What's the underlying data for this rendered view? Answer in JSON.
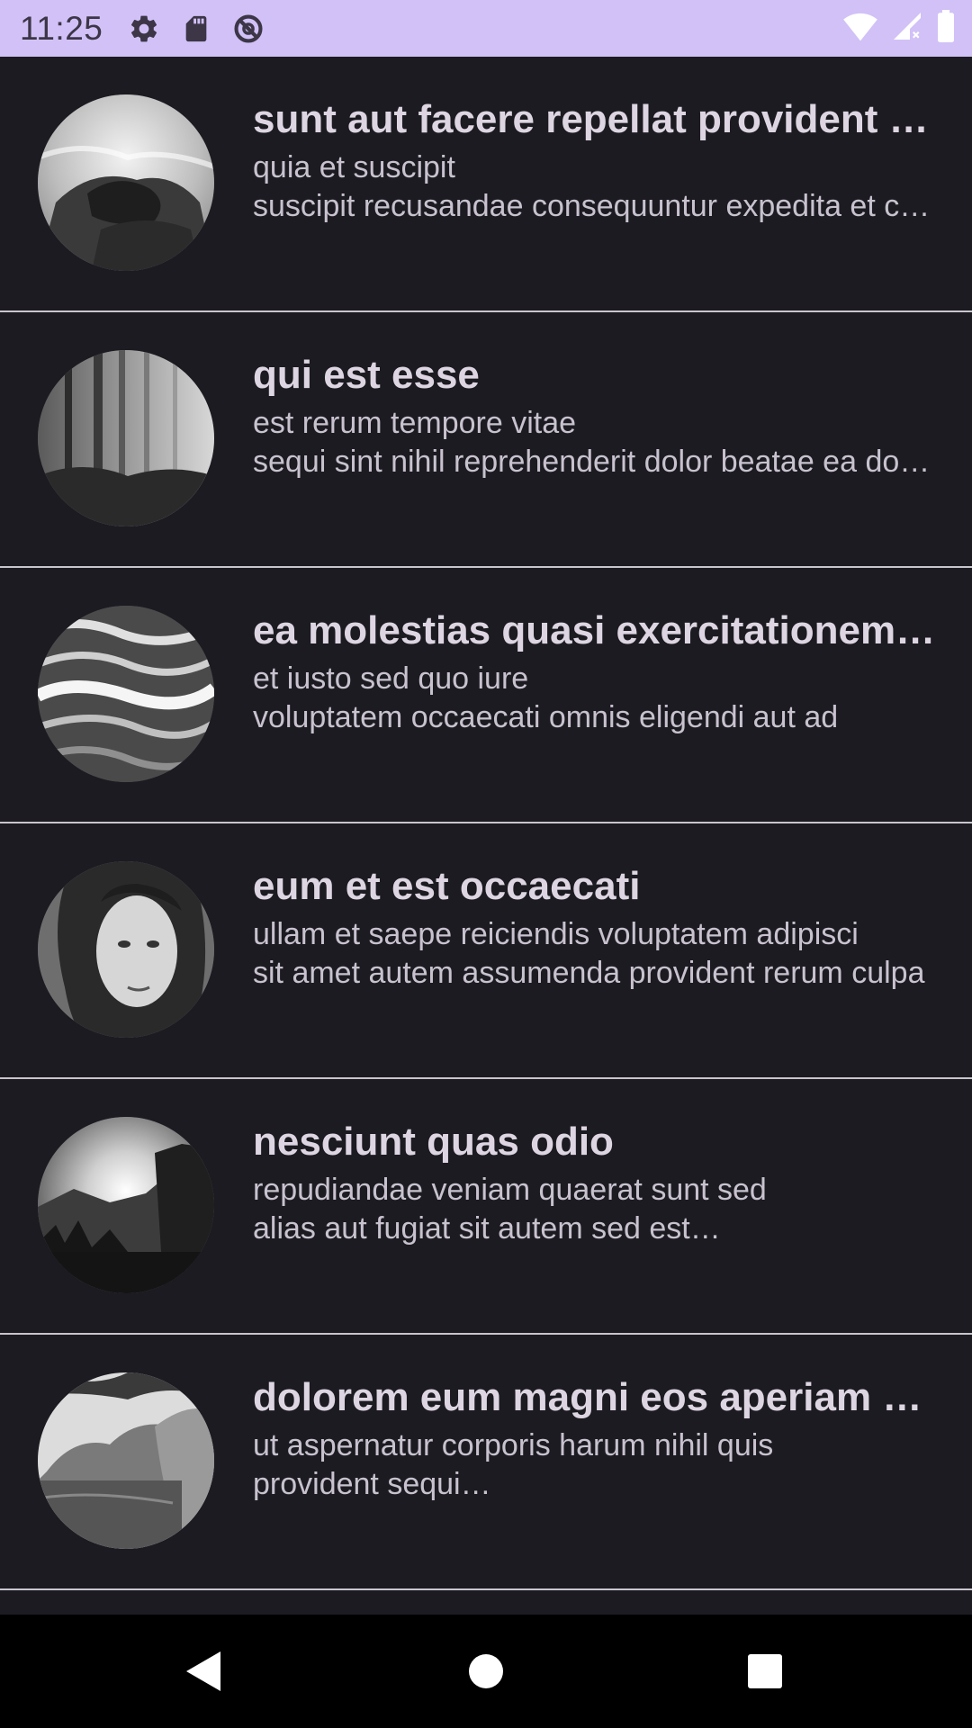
{
  "status_bar": {
    "time": "11:25",
    "left_icons": [
      "settings-icon",
      "sd-card-icon",
      "data-saver-icon"
    ],
    "right_icons": [
      "wifi-icon",
      "cellular-signal-icon",
      "battery-icon"
    ]
  },
  "posts": [
    {
      "title": "sunt aut facere repellat provident occaecati excepturi optio reprehenderit",
      "line1": "quia et suscipit",
      "line2": "suscipit recusandae consequuntur expedita et cum",
      "image": "rock-waves-image"
    },
    {
      "title": "qui est esse",
      "line1": "est rerum tempore vitae",
      "line2": "sequi sint nihil reprehenderit dolor beatae ea dolores neque",
      "image": "misty-forest-image"
    },
    {
      "title": "ea molestias quasi exercitationem repellat qui ipsa sit aut",
      "line1": "et iusto sed quo iure",
      "line2": "voluptatem occaecati omnis eligendi aut ad",
      "image": "ocean-waves-image"
    },
    {
      "title": "eum et est occaecati",
      "line1": "ullam et saepe reiciendis voluptatem adipisci",
      "line2": "sit amet autem assumenda provident rerum culpa",
      "image": "woman-portrait-image"
    },
    {
      "title": "nesciunt quas odio",
      "line1": "repudiandae veniam quaerat sunt sed",
      "line2": "alias aut fugiat sit autem sed est…",
      "image": "valley-sunrise-image"
    },
    {
      "title": "dolorem eum magni eos aperiam quia",
      "line1": "ut aspernatur corporis harum nihil quis",
      "line2": "provident sequi…",
      "image": "coastal-cliff-image"
    }
  ],
  "nav_bar": {
    "buttons": [
      "back-icon",
      "home-icon",
      "recents-icon"
    ]
  },
  "colors": {
    "background": "#1c1b21",
    "status_bar": "#d1c1f7",
    "divider": "#c9c5cf",
    "title_text": "#ddd6e2",
    "body_text": "#c8c2cf"
  }
}
